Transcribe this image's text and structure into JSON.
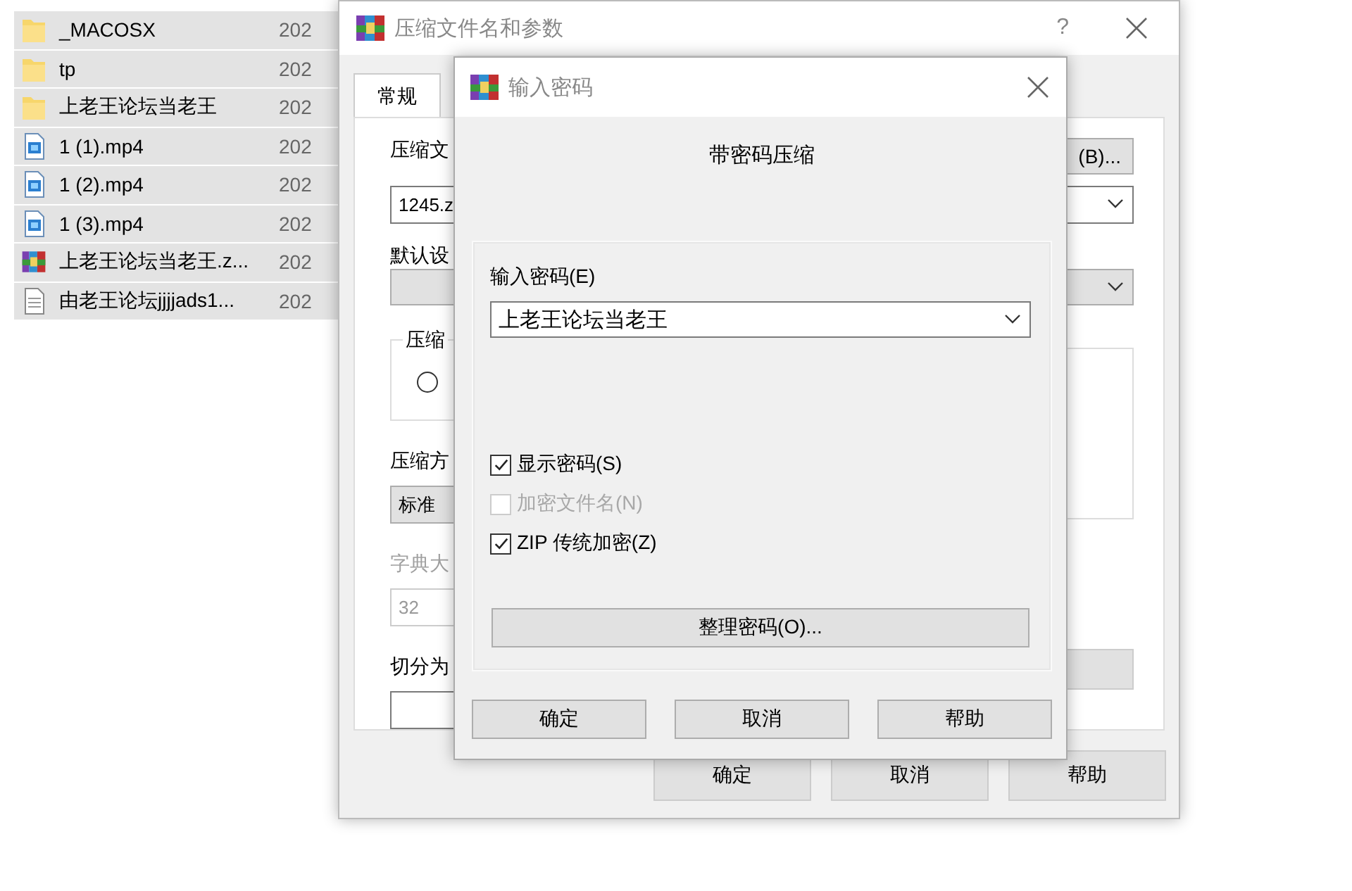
{
  "file_list": {
    "items": [
      {
        "name": "_MACOSX",
        "date": "202",
        "kind": "folder",
        "selected": true
      },
      {
        "name": "tp",
        "date": "202",
        "kind": "folder",
        "selected": true
      },
      {
        "name": "上老王论坛当老王",
        "date": "202",
        "kind": "folder",
        "selected": true
      },
      {
        "name": "1 (1).mp4",
        "date": "202",
        "kind": "video",
        "selected": true
      },
      {
        "name": "1 (2).mp4",
        "date": "202",
        "kind": "video",
        "selected": true
      },
      {
        "name": "1 (3).mp4",
        "date": "202",
        "kind": "video",
        "selected": true
      },
      {
        "name": "上老王论坛当老王.z...",
        "date": "202",
        "kind": "archive",
        "selected": true
      },
      {
        "name": "由老王论坛jjjjads1...",
        "date": "202",
        "kind": "text",
        "selected": true
      }
    ]
  },
  "archive_dialog": {
    "title": "压缩文件名和参数",
    "help": "?",
    "tabs": [
      {
        "label": "常规",
        "selected": true
      }
    ],
    "archive_name_label": "压缩文",
    "archive_name_value": "1245.z",
    "browse_button": "(B)...",
    "profile_label": "默认设",
    "format_group_label": "压缩",
    "format_radio": {
      "selected": false
    },
    "method_label": "压缩方",
    "method_value": "标准",
    "dict_label": "字典大",
    "dict_value": "32",
    "dict_disabled": true,
    "split_label": "切分为",
    "buttons": [
      "确定",
      "取消",
      "帮助"
    ]
  },
  "password_dialog": {
    "title": "输入密码",
    "heading": "带密码压缩",
    "password_label": "输入密码(E)",
    "password_value": "上老王论坛当老王",
    "checkboxes": [
      {
        "label": "显示密码(S)",
        "checked": true,
        "disabled": false
      },
      {
        "label": "加密文件名(N)",
        "checked": false,
        "disabled": true
      },
      {
        "label": "ZIP 传统加密(Z)",
        "checked": true,
        "disabled": false
      }
    ],
    "organize_button": "整理密码(O)...",
    "buttons": [
      "确定",
      "取消",
      "帮助"
    ]
  }
}
